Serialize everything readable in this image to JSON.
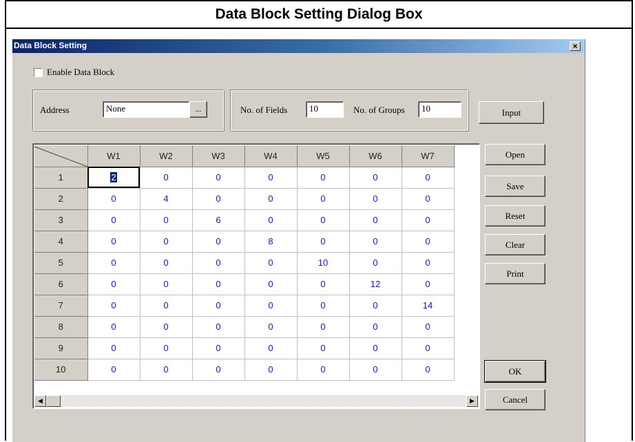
{
  "doc_title": "Data Block Setting Dialog Box",
  "dialog": {
    "title": "Data Block Setting",
    "close_label": "×",
    "enable_label": "Enable Data Block",
    "enable_checked": false,
    "address_label": "Address",
    "address_value": "None",
    "browse_label": "...",
    "fields_label": "No. of Fields",
    "fields_value": "10",
    "groups_label": "No. of Groups",
    "groups_value": "10",
    "input_label": "Input",
    "buttons": {
      "open": "Open",
      "save": "Save",
      "reset": "Reset",
      "clear": "Clear",
      "print": "Print",
      "ok": "OK",
      "cancel": "Cancel"
    },
    "grid": {
      "columns": [
        "W1",
        "W2",
        "W3",
        "W4",
        "W5",
        "W6",
        "W7"
      ],
      "rows": [
        {
          "label": "1",
          "cells": [
            "2",
            "0",
            "0",
            "0",
            "0",
            "0",
            "0"
          ]
        },
        {
          "label": "2",
          "cells": [
            "0",
            "4",
            "0",
            "0",
            "0",
            "0",
            "0"
          ]
        },
        {
          "label": "3",
          "cells": [
            "0",
            "0",
            "6",
            "0",
            "0",
            "0",
            "0"
          ]
        },
        {
          "label": "4",
          "cells": [
            "0",
            "0",
            "0",
            "8",
            "0",
            "0",
            "0"
          ]
        },
        {
          "label": "5",
          "cells": [
            "0",
            "0",
            "0",
            "0",
            "10",
            "0",
            "0"
          ]
        },
        {
          "label": "6",
          "cells": [
            "0",
            "0",
            "0",
            "0",
            "0",
            "12",
            "0"
          ]
        },
        {
          "label": "7",
          "cells": [
            "0",
            "0",
            "0",
            "0",
            "0",
            "0",
            "14"
          ]
        },
        {
          "label": "8",
          "cells": [
            "0",
            "0",
            "0",
            "0",
            "0",
            "0",
            "0"
          ]
        },
        {
          "label": "9",
          "cells": [
            "0",
            "0",
            "0",
            "0",
            "0",
            "0",
            "0"
          ]
        },
        {
          "label": "10",
          "cells": [
            "0",
            "0",
            "0",
            "0",
            "0",
            "0",
            "0"
          ]
        }
      ],
      "scroll_left_icon": "arrow-left-icon",
      "scroll_right_icon": "arrow-right-icon"
    }
  }
}
